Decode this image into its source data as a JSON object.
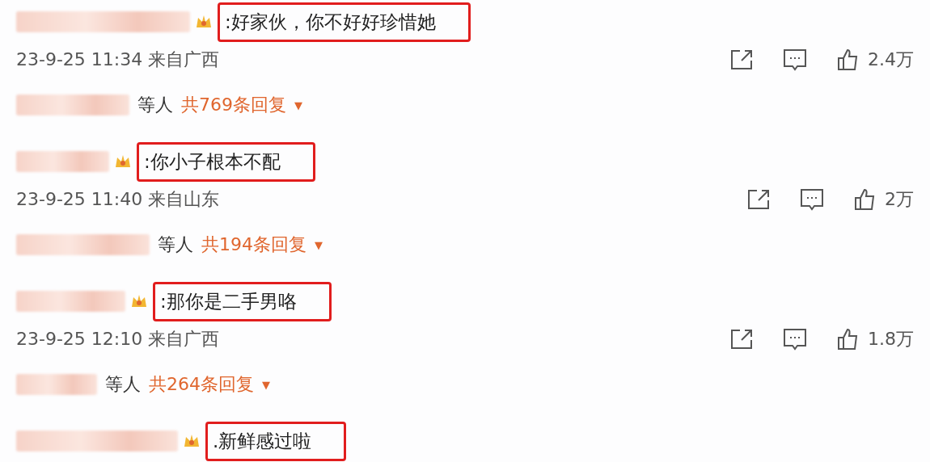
{
  "comments": [
    {
      "text": ":好家伙，你不好好珍惜她",
      "time": "23-9-25 11:34",
      "location": "来自广西",
      "likes": "2.4万",
      "repliers_suffix": "等人",
      "reply_count": "共769条回复",
      "caret": "▼"
    },
    {
      "text": ":你小子根本不配",
      "time": "23-9-25 11:40",
      "location": "来自山东",
      "likes": "2万",
      "repliers_suffix": "等人",
      "reply_count": "共194条回复",
      "caret": "▼"
    },
    {
      "text": ":那你是二手男咯",
      "time": "23-9-25 12:10",
      "location": "来自广西",
      "likes": "1.8万",
      "repliers_suffix": "等人",
      "reply_count": "共264条回复",
      "caret": "▼"
    },
    {
      "text": ".新鲜感过啦"
    }
  ]
}
